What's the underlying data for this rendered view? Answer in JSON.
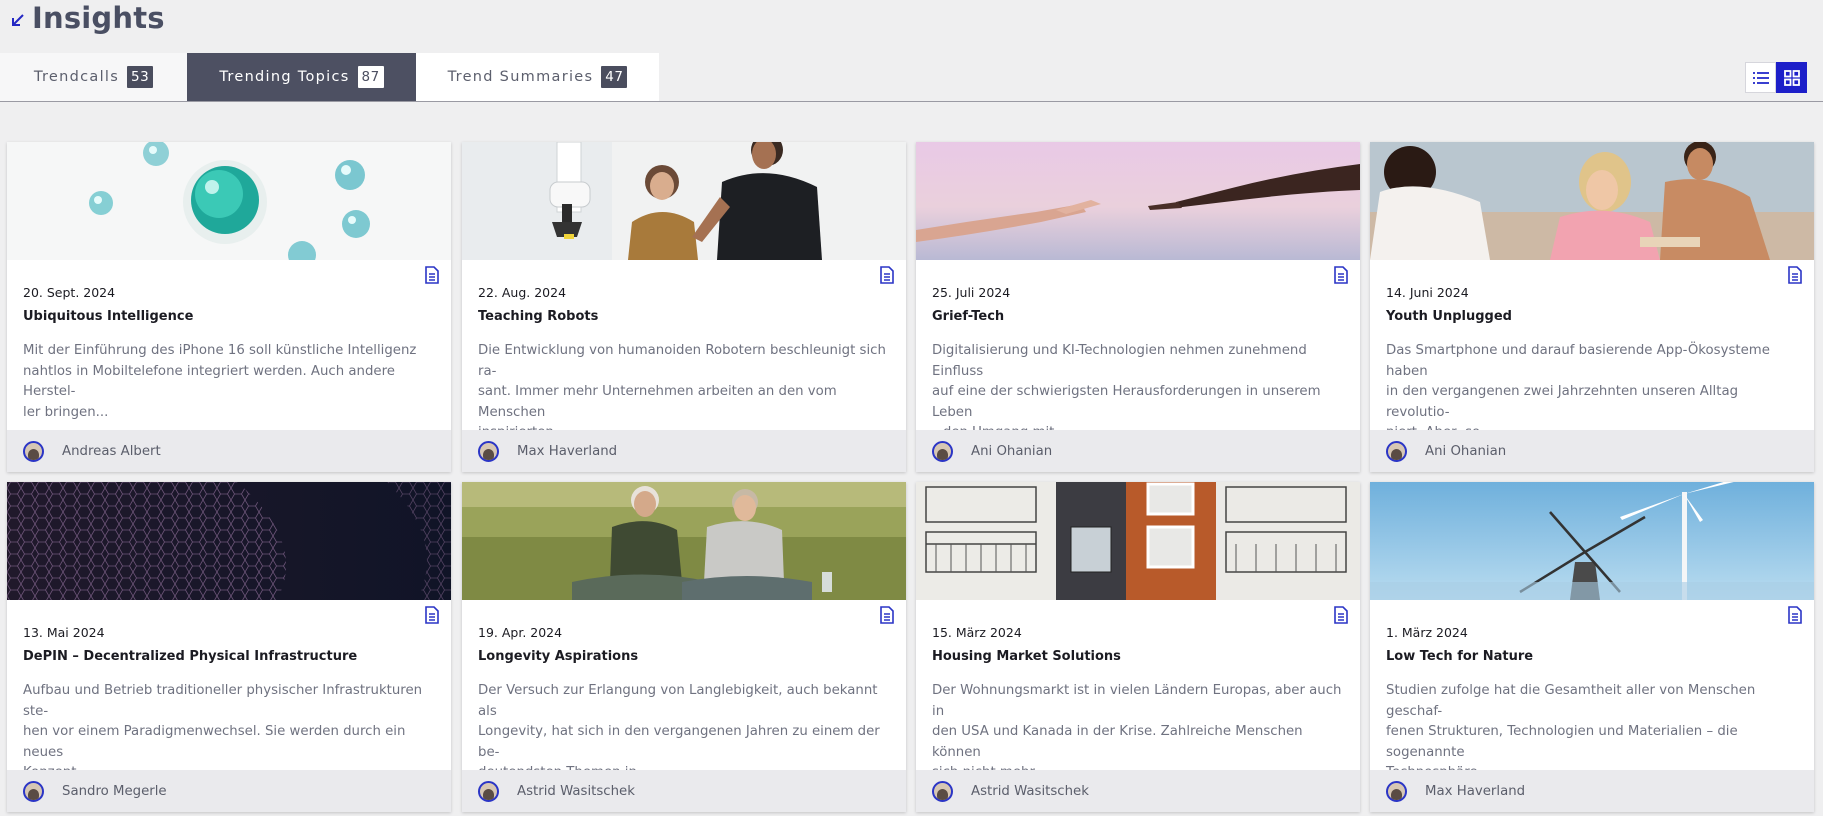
{
  "header": {
    "title": "Insights"
  },
  "tabs": [
    {
      "label": "Trendcalls",
      "count": "53"
    },
    {
      "label": "Trending Topics",
      "count": "87"
    },
    {
      "label": "Trend Summaries",
      "count": "47"
    }
  ],
  "view_toggle": {
    "list_icon": "list-icon",
    "grid_icon": "grid-icon",
    "active": "grid"
  },
  "colors": {
    "accent": "#1d1fc9",
    "tab_active": "#4d5062",
    "title": "#4a4f63"
  },
  "cards": [
    {
      "date": "20. Sept. 2024",
      "title": "Ubiquitous Intelligence",
      "excerpt": [
        "Mit der Einführung des iPhone 16 soll künstliche Intelligenz",
        "nahtlos in Mobiltelefone integriert werden. Auch andere Herstel-",
        "ler bringen..."
      ],
      "author": "Andreas Albert",
      "image": "teal glass droplets"
    },
    {
      "date": "22. Aug. 2024",
      "title": "Teaching Robots",
      "excerpt": [
        "Die Entwicklung von humanoiden Robotern beschleunigt sich ra-",
        "sant. Immer mehr Unternehmen arbeiten an den vom Menschen",
        "inspirierten..."
      ],
      "author": "Max Haverland",
      "image": "people with robot arm"
    },
    {
      "date": "25. Juli 2024",
      "title": "Grief-Tech",
      "excerpt": [
        "Digitalisierung und KI-Technologien nehmen zunehmend Einfluss",
        "auf eine der schwierigsten Herausforderungen in unserem Leben",
        "– den Umgang mit..."
      ],
      "author": "Ani Ohanian",
      "image": "reaching hands at dusk"
    },
    {
      "date": "14. Juni 2024",
      "title": "Youth Unplugged",
      "excerpt": [
        "Das Smartphone und darauf basierende App-Ökosysteme haben",
        "in den vergangenen zwei Jahrzehnten unseren Alltag revolutio-",
        "niert. Aber, so..."
      ],
      "author": "Ani Ohanian",
      "image": "youths at the beach"
    },
    {
      "date": "13. Mai 2024",
      "title": "DePIN – Decentralized Physical Infrastructure",
      "excerpt": [
        "Aufbau und Betrieb traditioneller physischer Infrastrukturen ste-",
        "hen vor einem Paradigmenwechsel. Sie werden durch ein neues",
        "Konzept..."
      ],
      "author": "Sandro Megerle",
      "image": "hexagon mesh"
    },
    {
      "date": "19. Apr. 2024",
      "title": "Longevity Aspirations",
      "excerpt": [
        "Der Versuch zur Erlangung von Langlebigkeit, auch bekannt als",
        "Longevity, hat sich in den vergangenen Jahren zu einem der be-",
        "deutendsten Themen in..."
      ],
      "author": "Astrid Wasitschek",
      "image": "seniors doing yoga"
    },
    {
      "date": "15. März 2024",
      "title": "Housing Market Solutions",
      "excerpt": [
        "Der Wohnungsmarkt ist in vielen Ländern Europas, aber auch in",
        "den USA und Kanada in der Krise. Zahlreiche Menschen können",
        "sich nicht mehr..."
      ],
      "author": "Astrid Wasitschek",
      "image": "apartment balconies"
    },
    {
      "date": "1. März 2024",
      "title": "Low Tech for Nature",
      "excerpt": [
        "Studien zufolge hat die Gesamtheit aller von Menschen geschaf-",
        "fenen Strukturen, Technologien und Materialien – die sogenannte",
        "Technosphäre..."
      ],
      "author": "Max Haverland",
      "image": "windmill and wind turbine"
    }
  ]
}
